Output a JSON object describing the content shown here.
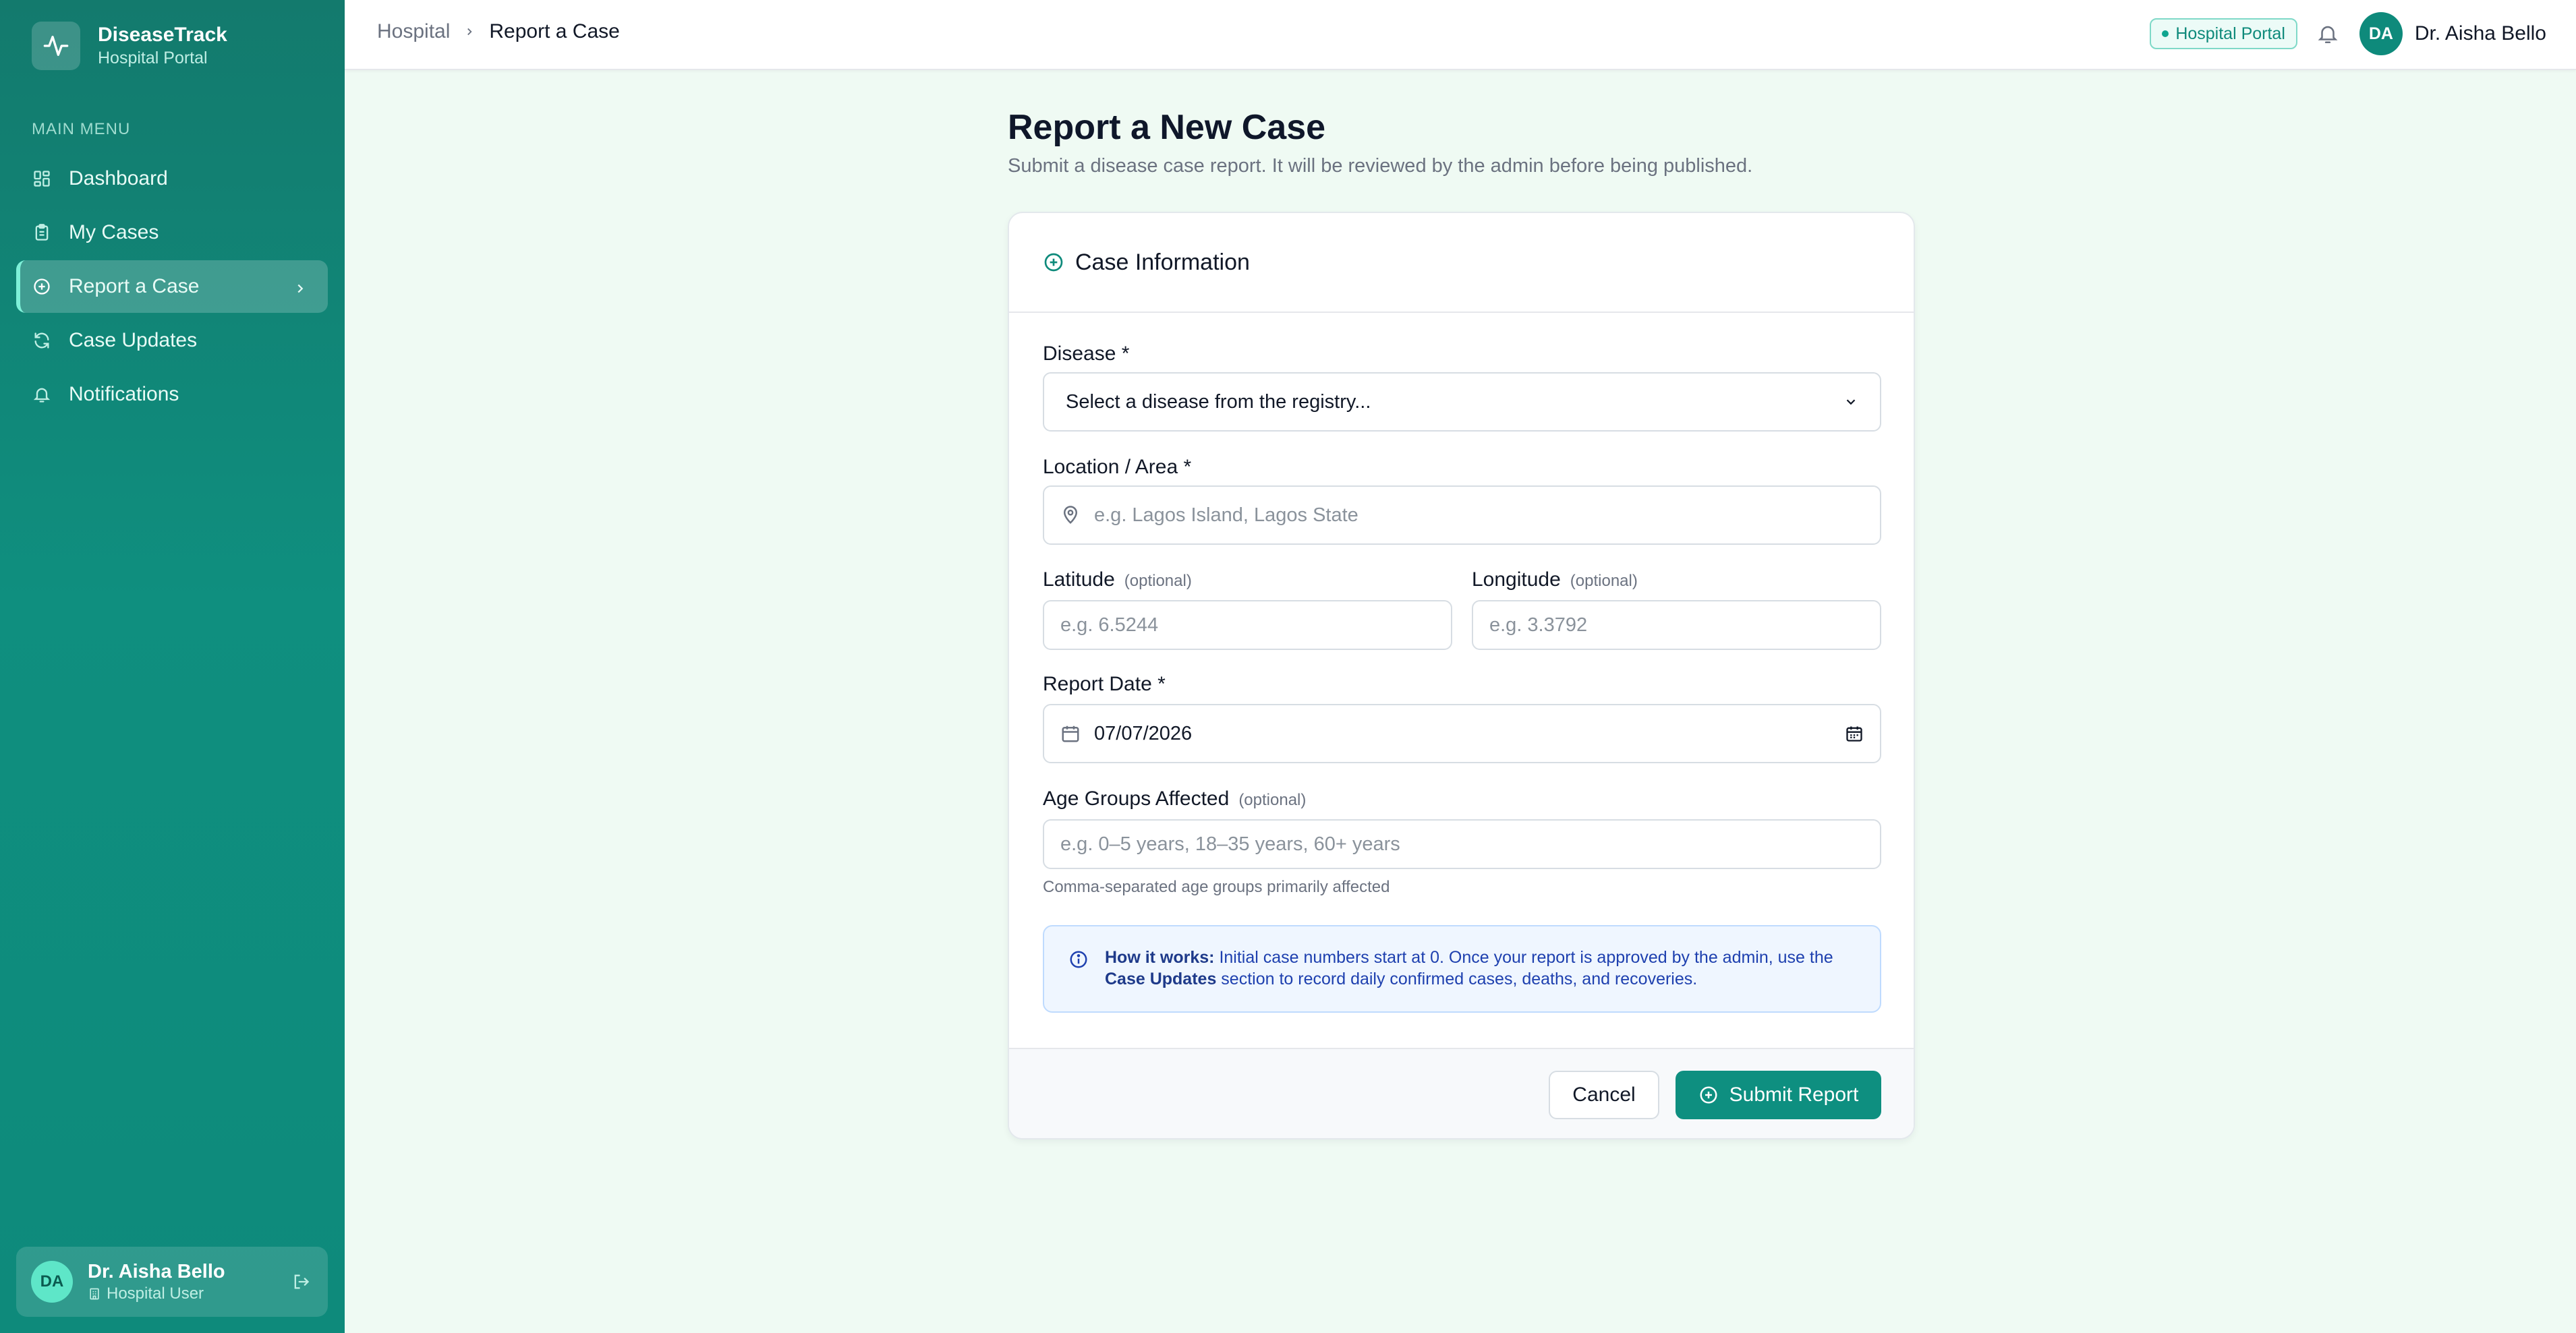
{
  "app": {
    "name": "DiseaseTrack",
    "subtitle": "Hospital Portal"
  },
  "sidebar": {
    "section_title": "MAIN MENU",
    "items": [
      {
        "label": "Dashboard",
        "icon": "grid-icon"
      },
      {
        "label": "My Cases",
        "icon": "clipboard-icon"
      },
      {
        "label": "Report a Case",
        "icon": "plus-circle-icon",
        "active": true
      },
      {
        "label": "Case Updates",
        "icon": "refresh-icon"
      },
      {
        "label": "Notifications",
        "icon": "bell-icon"
      }
    ],
    "user": {
      "initials": "DA",
      "name": "Dr. Aisha Bello",
      "role": "Hospital User"
    }
  },
  "topbar": {
    "breadcrumb": [
      "Hospital",
      "Report a Case"
    ],
    "badge": "Hospital Portal",
    "user_initials": "DA",
    "user_name": "Dr. Aisha Bello"
  },
  "page": {
    "title": "Report a New Case",
    "subtitle": "Submit a disease case report. It will be reviewed by the admin before being published."
  },
  "form": {
    "section_title": "Case Information",
    "disease": {
      "label": "Disease *",
      "selected": "Select a disease from the registry..."
    },
    "location": {
      "label": "Location / Area *",
      "placeholder": "e.g. Lagos Island, Lagos State"
    },
    "latitude": {
      "label": "Latitude",
      "optional": "(optional)",
      "placeholder": "e.g. 6.5244"
    },
    "longitude": {
      "label": "Longitude",
      "optional": "(optional)",
      "placeholder": "e.g. 3.3792"
    },
    "report_date": {
      "label": "Report Date *",
      "value": "07/07/2026"
    },
    "age_groups": {
      "label": "Age Groups Affected",
      "optional": "(optional)",
      "placeholder": "e.g. 0–5 years, 18–35 years, 60+ years",
      "help": "Comma-separated age groups primarily affected"
    },
    "info": {
      "lead": "How it works:",
      "text1": " Initial case numbers start at 0. Once your report is approved by the admin, use the",
      "link": "Case Updates",
      "text2": " section to record daily confirmed cases, deaths, and recoveries."
    },
    "cancel_label": "Cancel",
    "submit_label": "Submit Report"
  },
  "colors": {
    "brand": "#0e8a7b",
    "info_bg": "#eff6ff",
    "info_text": "#1e40af",
    "page_bg": "#effaf3"
  }
}
